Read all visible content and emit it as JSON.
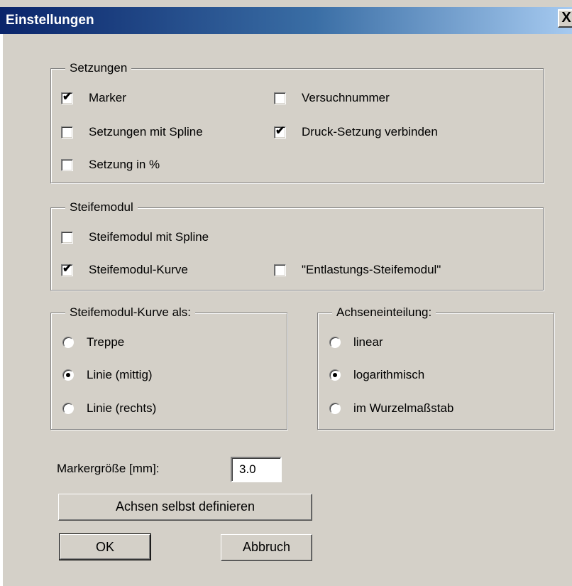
{
  "window": {
    "title": "Einstellungen",
    "close_glyph": "X"
  },
  "setzungen": {
    "legend": "Setzungen",
    "marker": {
      "label": "Marker",
      "checked": true
    },
    "versuchnummer": {
      "label": "Versuchnummer",
      "checked": false
    },
    "spline": {
      "label": "Setzungen mit Spline",
      "checked": false
    },
    "druck": {
      "label": "Druck-Setzung verbinden",
      "checked": true
    },
    "prozent": {
      "label": "Setzung in %",
      "checked": false
    }
  },
  "steifemodul": {
    "legend": "Steifemodul",
    "spline": {
      "label": "Steifemodul mit Spline",
      "checked": false
    },
    "kurve": {
      "label": "Steifemodul-Kurve",
      "checked": true
    },
    "entlastung": {
      "label": "\"Entlastungs-Steifemodul\"",
      "checked": false
    }
  },
  "kurve_als": {
    "legend": "Steifemodul-Kurve als:",
    "options": [
      "Treppe",
      "Linie (mittig)",
      "Linie (rechts)"
    ],
    "selected": "Linie (mittig)"
  },
  "achsen": {
    "legend": "Achseneinteilung:",
    "options": [
      "linear",
      "logarithmisch",
      "im Wurzelmaßstab"
    ],
    "selected": "logarithmisch"
  },
  "marker_size": {
    "label": "Markergröße [mm]:",
    "value": "3.0"
  },
  "buttons": {
    "define_axes": "Achsen selbst definieren",
    "ok": "OK",
    "cancel": "Abbruch"
  },
  "check_glyph": "✔"
}
